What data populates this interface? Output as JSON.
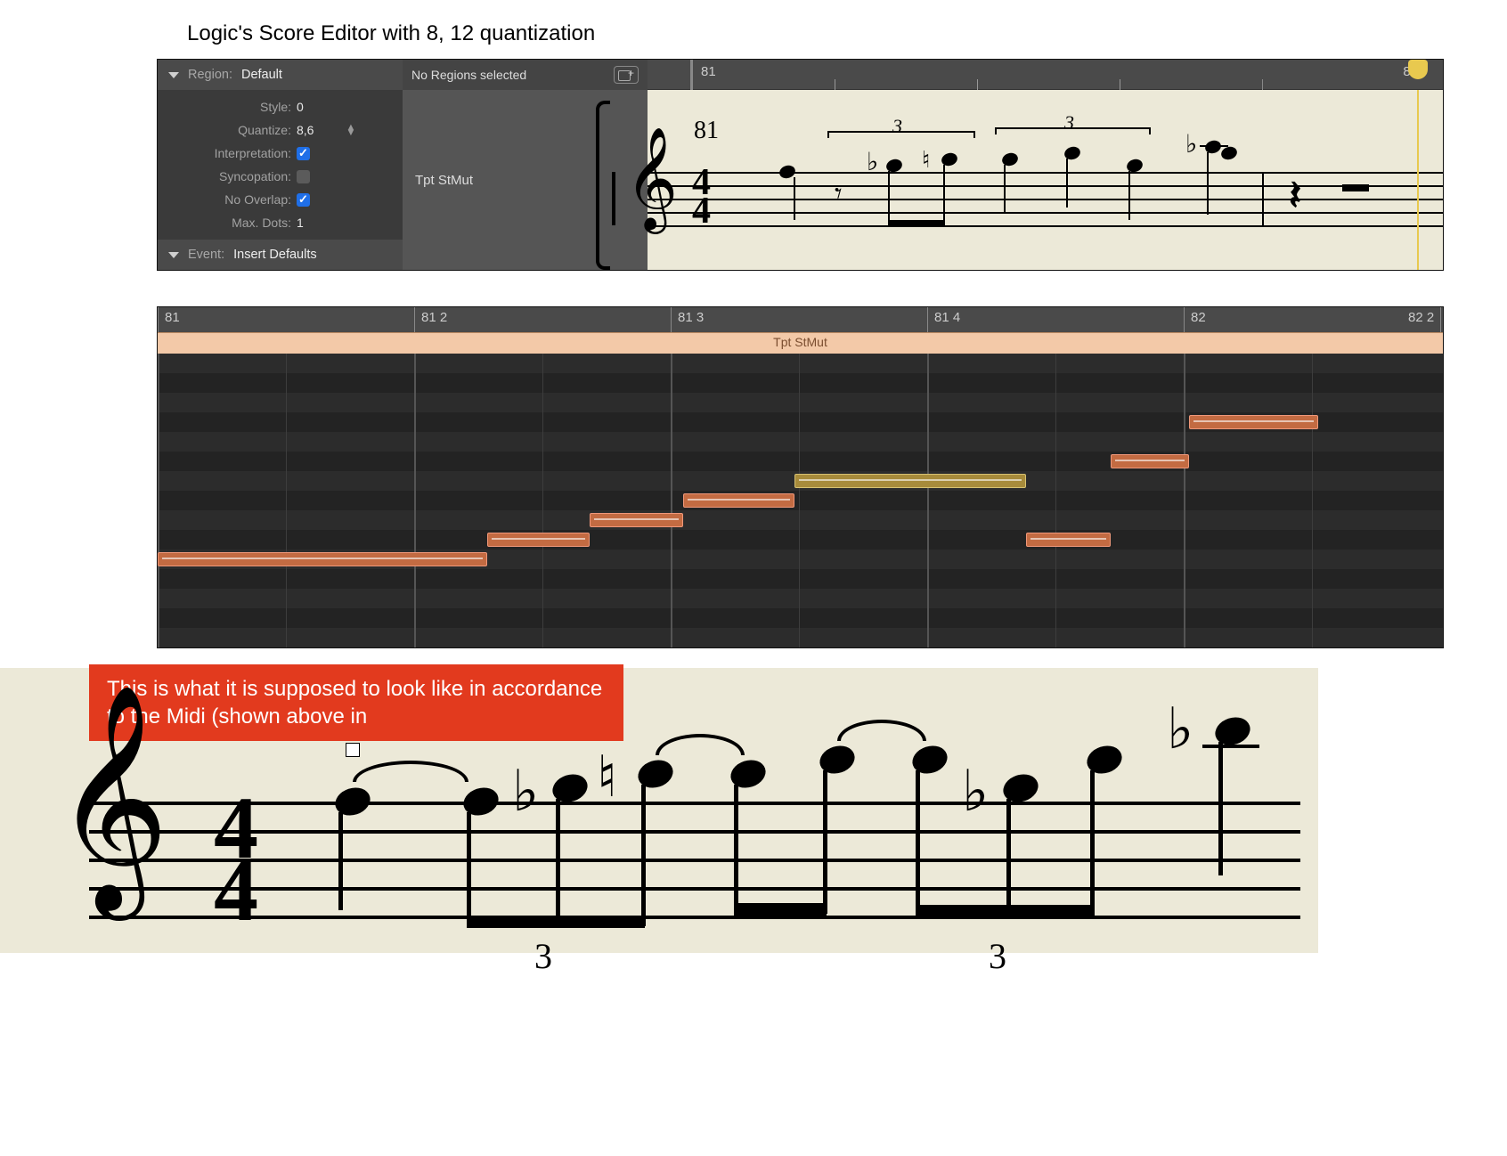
{
  "caption": "Logic's Score Editor with 8, 12 quantization",
  "inspector": {
    "region_label": "Region:",
    "region_value": "Default",
    "style_label": "Style:",
    "style_value": "0",
    "quantize_label": "Quantize:",
    "quantize_value": "8,6",
    "interpretation_label": "Interpretation:",
    "interpretation_on": true,
    "syncopation_label": "Syncopation:",
    "syncopation_on": false,
    "nooverlap_label": "No Overlap:",
    "nooverlap_on": true,
    "maxdots_label": "Max. Dots:",
    "maxdots_value": "1",
    "event_label": "Event:",
    "event_value": "Insert Defaults"
  },
  "track": {
    "no_regions": "No Regions selected",
    "name": "Tpt StMut"
  },
  "score_ruler": {
    "m81": "81",
    "m82": "82"
  },
  "score_bar_number": "81",
  "time_signature": {
    "top": "4",
    "bottom": "4"
  },
  "tuplet_label": "3",
  "piano_roll": {
    "markers": [
      "81",
      "81 2",
      "81 3",
      "81 4",
      "82",
      "82 2"
    ],
    "region_name": "Tpt StMut",
    "notes": [
      {
        "row": 10,
        "start": 0,
        "len": 370,
        "color": "orange"
      },
      {
        "row": 9,
        "start": 370,
        "len": 115,
        "color": "orange"
      },
      {
        "row": 8,
        "start": 485,
        "len": 105,
        "color": "orange"
      },
      {
        "row": 7,
        "start": 590,
        "len": 125,
        "color": "orange"
      },
      {
        "row": 6,
        "start": 715,
        "len": 260,
        "color": "olive"
      },
      {
        "row": 9,
        "start": 975,
        "len": 95,
        "color": "orange"
      },
      {
        "row": 5,
        "start": 1070,
        "len": 88,
        "color": "orange"
      },
      {
        "row": 3,
        "start": 1158,
        "len": 145,
        "color": "orange"
      }
    ]
  },
  "annotation_text": "This is what it is supposed to look like in accordance to the Midi (shown above in",
  "reference": {
    "tuplet_label": "3"
  }
}
